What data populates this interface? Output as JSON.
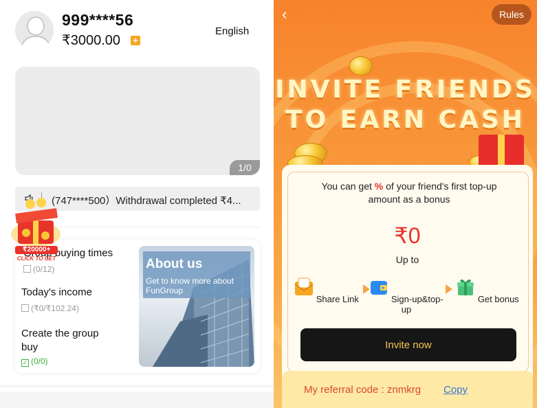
{
  "profile": {
    "phone": "999****56",
    "balance": "₹3000.00",
    "add_symbol": "+",
    "language": "English"
  },
  "banner": {
    "pager": "1/0"
  },
  "notice": {
    "text": "(747****500）Withdrawal completed ₹4..."
  },
  "promo_gift": {
    "amount": "₹20000+",
    "cta": "CLICK TO GET"
  },
  "tasks": [
    {
      "label": "Group buying times",
      "value": "(0/12)",
      "done": false
    },
    {
      "label": "Today's income",
      "value": "(₹0/₹102.24)",
      "done": false
    },
    {
      "label": "Create the group buy",
      "value": "(0/0)",
      "done": true
    }
  ],
  "about": {
    "title": "About us",
    "description": "Get to know more about FunGroup"
  },
  "invite": {
    "back_icon": "chevron-left-icon",
    "rules": "Rules",
    "hero_line1": "INVITE FRIENDS",
    "hero_line2": "TO EARN CASH",
    "desc_before": "You can get ",
    "desc_pct": "%",
    "desc_after": " of your friend's first top-up amount as a bonus",
    "amount": "₹0",
    "up_to": "Up to",
    "steps": [
      {
        "label": "Share Link",
        "icon": "envelope-icon"
      },
      {
        "label": "Sign-up&top-up",
        "icon": "wallet-icon"
      },
      {
        "label": "Get bonus",
        "icon": "gift-icon"
      }
    ],
    "invite_button": "Invite now",
    "referral_label": "My referral code : ",
    "referral_code": "znmkrg",
    "copy": "Copy"
  },
  "colors": {
    "accent_orange": "#f7832c",
    "red": "#e8332a",
    "button_dark": "#161616",
    "button_text": "#f5c451",
    "link_blue": "#3a76d8",
    "success_green": "#3db03d"
  }
}
